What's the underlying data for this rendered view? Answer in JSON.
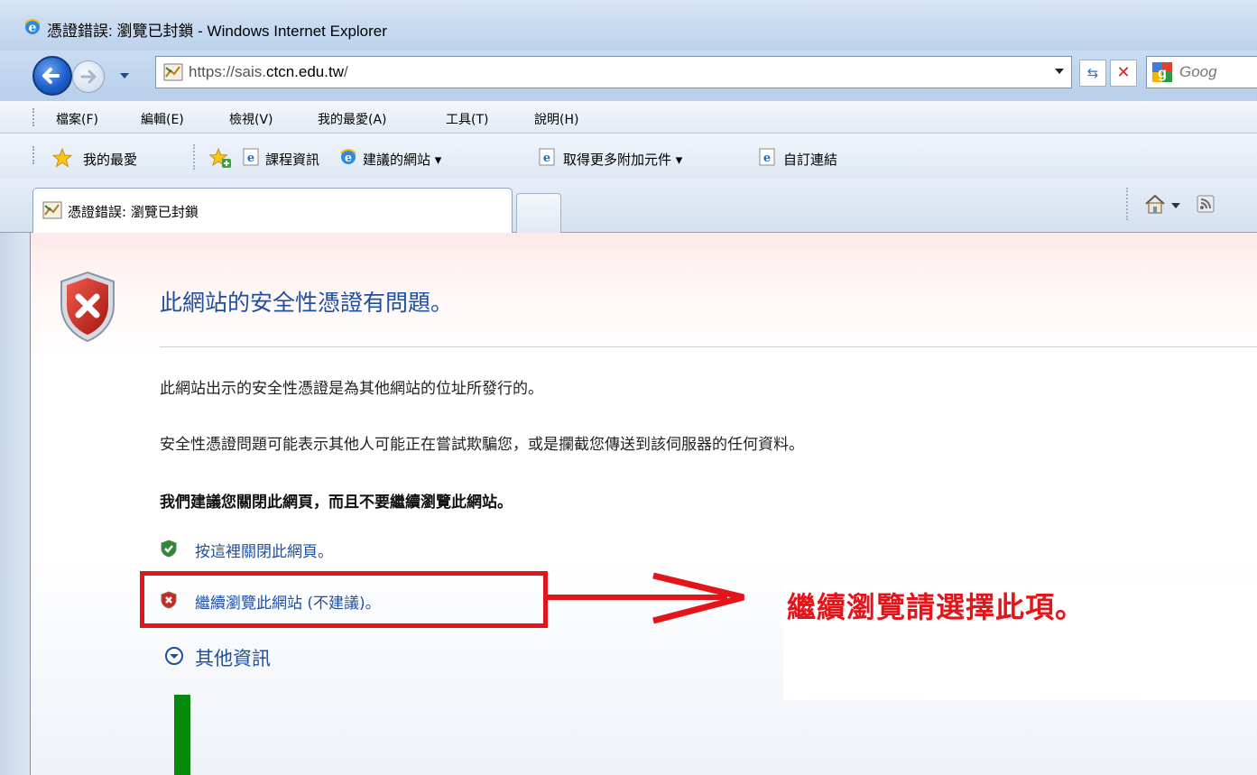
{
  "window": {
    "title": "憑證錯誤: 瀏覽已封鎖 - Windows Internet Explorer"
  },
  "address_bar": {
    "url_prefix": "https://sais.",
    "url_host": "ctcn.edu.tw",
    "url_suffix": "/",
    "search_placeholder": "Goog"
  },
  "menu": {
    "items": [
      "檔案(F)",
      "編輯(E)",
      "檢視(V)",
      "我的最愛(A)",
      "工具(T)",
      "說明(H)"
    ]
  },
  "favorites_bar": {
    "favorites_label": "我的最愛",
    "links": [
      "課程資訊",
      "建議的網站 ▾",
      "取得更多附加元件 ▾",
      "自訂連結"
    ]
  },
  "tabs": {
    "active_label": "憑證錯誤: 瀏覽已封鎖"
  },
  "error_page": {
    "title": "此網站的安全性憑證有問題。",
    "para1": "此網站出示的安全性憑證是為其他網站的位址所發行的。",
    "para2": "安全性憑證問題可能表示其他人可能正在嘗試欺騙您，或是攔截您傳送到該伺服器的任何資料。",
    "recommendation": "我們建議您關閉此網頁，而且不要繼續瀏覽此網站。",
    "close_link": "按這裡關閉此網頁。",
    "continue_link": "繼續瀏覽此網站 (不建議)。",
    "more_info": "其他資訊"
  },
  "annotation": {
    "note": "繼續瀏覽請選擇此項。",
    "highlight_color": "#e3151a"
  },
  "icons": {
    "shield_error": "shield-error-icon",
    "shield_ok": "shield-check-icon",
    "expand": "chevron-down-circle-icon"
  }
}
